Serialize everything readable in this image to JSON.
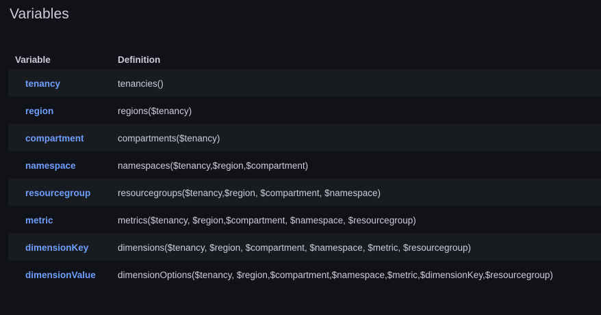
{
  "page": {
    "title": "Variables"
  },
  "table": {
    "headers": {
      "variable": "Variable",
      "definition": "Definition"
    },
    "rows": [
      {
        "name": "tenancy",
        "definition": "tenancies()"
      },
      {
        "name": "region",
        "definition": "regions($tenancy)"
      },
      {
        "name": "compartment",
        "definition": "compartments($tenancy)"
      },
      {
        "name": "namespace",
        "definition": "namespaces($tenancy,$region,$compartment)"
      },
      {
        "name": "resourcegroup",
        "definition": "resourcegroups($tenancy,$region, $compartment, $namespace)"
      },
      {
        "name": "metric",
        "definition": "metrics($tenancy, $region,$compartment, $namespace, $resourcegroup)"
      },
      {
        "name": "dimensionKey",
        "definition": "dimensions($tenancy, $region, $compartment, $namespace, $metric, $resourcegroup)"
      },
      {
        "name": "dimensionValue",
        "definition": "dimensionOptions($tenancy, $region,$compartment,$namespace,$metric,$dimensionKey,$resourcegroup)"
      }
    ]
  },
  "colors": {
    "background": "#111217",
    "row_stripe": "#181b1f",
    "link": "#6e9fff",
    "text": "#ccccdc"
  }
}
